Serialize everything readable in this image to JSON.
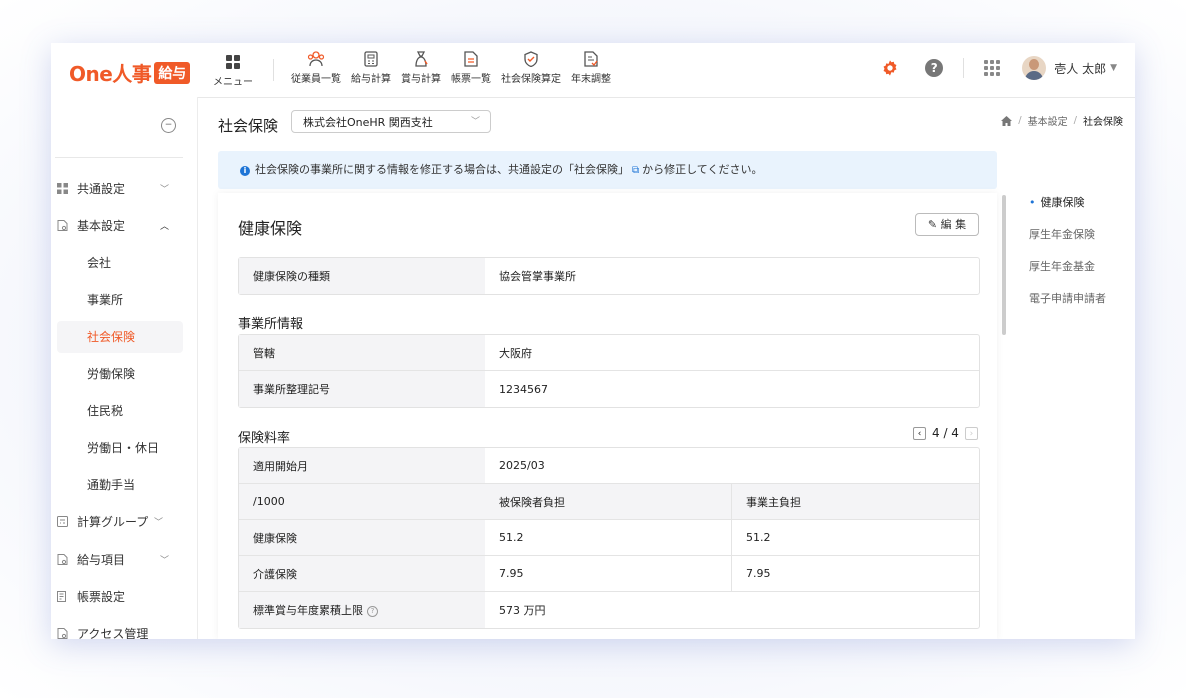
{
  "header": {
    "logo_text": "One人事",
    "logo_badge": "給与",
    "menu_label": "メニュー",
    "nav": [
      {
        "label": "従業員一覧",
        "icon": "employees-icon"
      },
      {
        "label": "給与計算",
        "icon": "payroll-icon"
      },
      {
        "label": "賞与計算",
        "icon": "bonus-icon"
      },
      {
        "label": "帳票一覧",
        "icon": "documents-icon"
      },
      {
        "label": "社会保険算定",
        "icon": "social-insurance-icon"
      },
      {
        "label": "年末調整",
        "icon": "year-end-icon"
      }
    ],
    "help_glyph": "?",
    "user_name": "壱人 太郎",
    "accent_color": "#f05a28"
  },
  "sidebar": {
    "items": [
      {
        "label": "共通設定",
        "chevron": "down"
      },
      {
        "label": "基本設定",
        "chevron": "up"
      },
      {
        "label": "計算グループ",
        "chevron": "down"
      },
      {
        "label": "給与項目",
        "chevron": "down"
      },
      {
        "label": "帳票設定",
        "chevron": ""
      },
      {
        "label": "アクセス管理",
        "chevron": ""
      }
    ],
    "sub_items": [
      "会社",
      "事業所",
      "社会保険",
      "労働保険",
      "住民税",
      "労働日・休日",
      "通勤手当"
    ],
    "active_sub": "社会保険"
  },
  "page": {
    "title": "社会保険",
    "company_selected": "株式会社OneHR 関西支社",
    "breadcrumb": [
      "基本設定",
      "社会保険"
    ],
    "info_text_1": "社会保険の事業所に関する情報を修正する場合は、共通設定の「社会保険」",
    "info_text_2": "から修正してください。"
  },
  "card": {
    "title": "健康保険",
    "edit_label": "編 集",
    "type_row": {
      "label": "健康保険の種類",
      "value": "協会管掌事業所"
    },
    "office_section_title": "事業所情報",
    "office_rows": [
      {
        "label": "管轄",
        "value": "大阪府"
      },
      {
        "label": "事業所整理記号",
        "value": "1234567"
      }
    ],
    "rate_section_title": "保険料率",
    "pager": "4 / 4",
    "rate_start": {
      "label": "適用開始月",
      "value": "2025/03"
    },
    "rate_header": [
      "/1000",
      "被保険者負担",
      "事業主負担"
    ],
    "rate_rows": [
      {
        "label": "健康保険",
        "employee": "51.2",
        "employer": "51.2"
      },
      {
        "label": "介護保険",
        "employee": "7.95",
        "employer": "7.95"
      }
    ],
    "limit_row": {
      "label": "標準賞与年度累積上限",
      "value": "573 万円"
    }
  },
  "toc": {
    "items": [
      "健康保険",
      "厚生年金保険",
      "厚生年金基金",
      "電子申請申請者"
    ],
    "active": "健康保険"
  }
}
